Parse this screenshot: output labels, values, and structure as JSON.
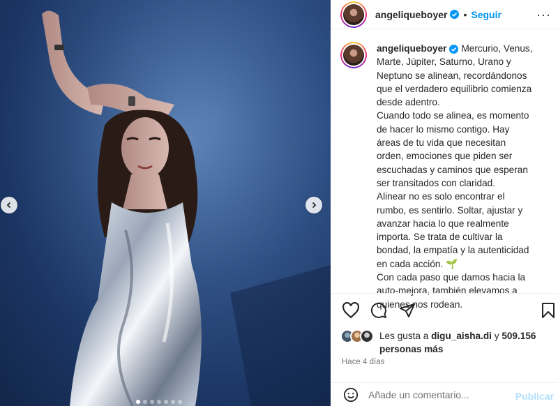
{
  "post": {
    "username": "angeliqueboyer",
    "separator": "•",
    "follow_label": "Seguir",
    "more_label": "···"
  },
  "caption": {
    "username": "angeliqueboyer",
    "paragraphs": [
      "Mercurio, Venus, Marte, Júpiter, Saturno, Urano y Neptuno se alinean, recordándonos que el verdadero equilibrio comienza desde adentro.",
      "Cuando todo se alinea, es momento de hacer lo mismo contigo. Hay áreas de tu vida que necesitan orden, emociones que piden ser escuchadas y caminos que esperan ser transitados con claridad.",
      "Alinear no es solo encontrar el rumbo, es sentirlo. Soltar, ajustar y avanzar hacia lo que realmente importa. Se trata de cultivar la bondad, la empatía y la autenticidad en cada acción. 🌱",
      "Con cada paso que damos hacia la auto-mejora, también elevamos a quienes nos rodean."
    ]
  },
  "likes": {
    "prefix": "Les gusta a",
    "liker": "digu_aisha.di",
    "conjunction": "y",
    "count": "509.156",
    "suffix": "personas más"
  },
  "timestamp": "Hace 4 días",
  "comment": {
    "placeholder": "Añade un comentario...",
    "publish_label": "Publicar"
  },
  "carousel": {
    "total_dots": 7,
    "active_index": 0
  },
  "icons": {
    "verified": "verified-badge-icon",
    "like": "heart-icon",
    "comment": "comment-bubble-icon",
    "share": "paper-plane-icon",
    "save": "bookmark-icon",
    "emoji": "smiley-icon",
    "prev": "chevron-left-icon",
    "next": "chevron-right-icon"
  },
  "colors": {
    "accent": "#0095f6",
    "publish_disabled": "#b2dffc",
    "muted": "#737373",
    "text": "#262626"
  }
}
